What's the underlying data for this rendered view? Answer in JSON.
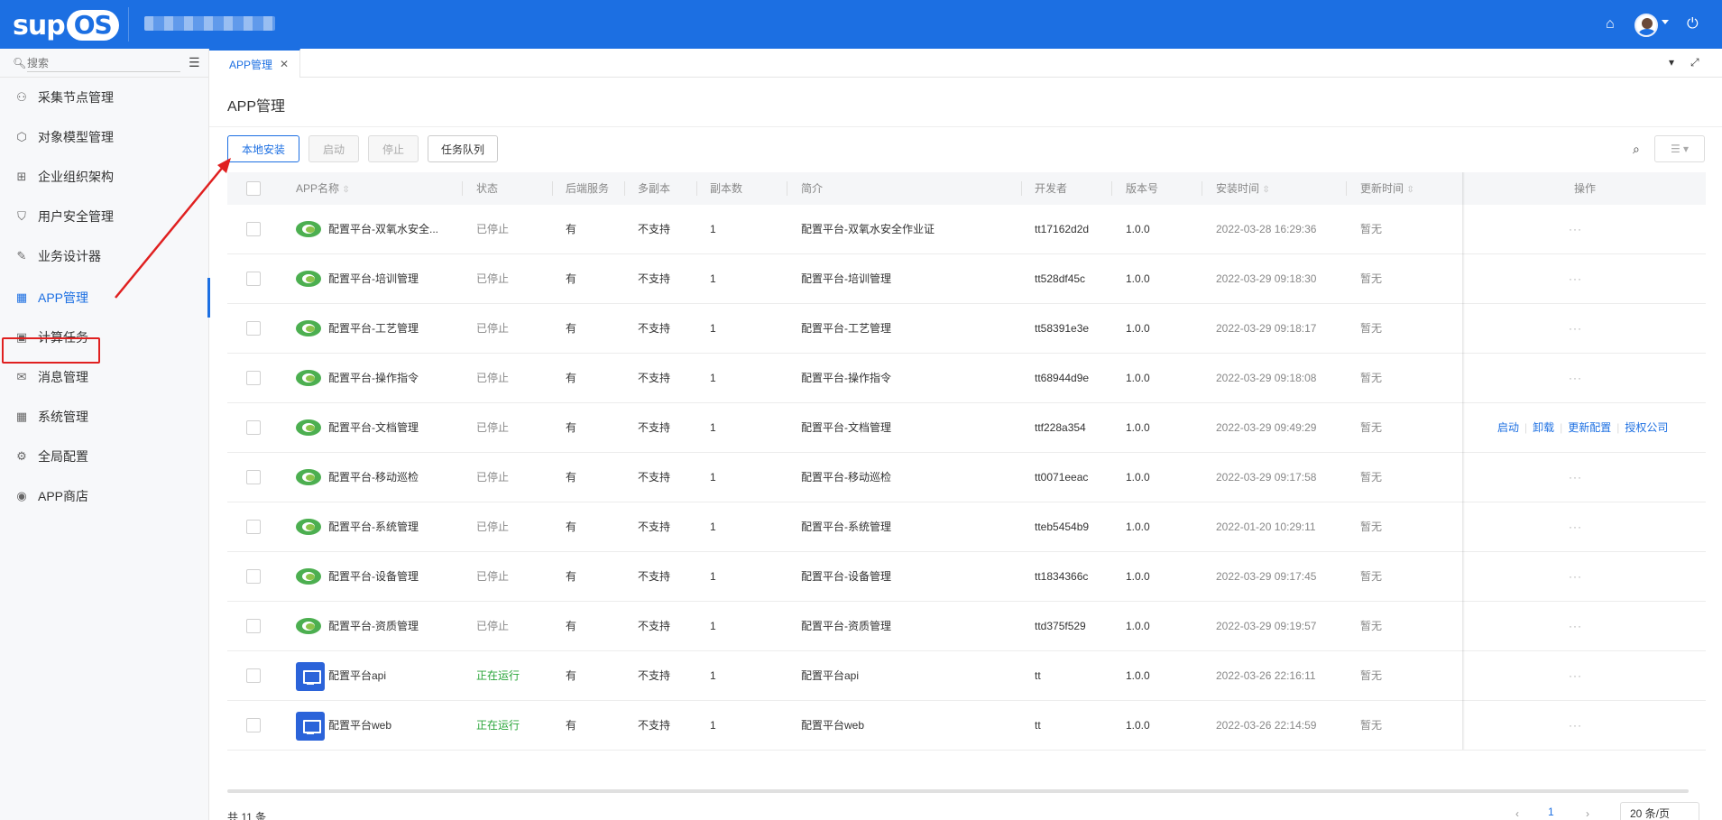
{
  "header": {
    "logo": {
      "sup": "sup",
      "os": "OS"
    },
    "home_icon": "home-icon",
    "power_icon": "power-icon"
  },
  "sidebar": {
    "search_placeholder": "搜索",
    "items": [
      {
        "label": "采集节点管理",
        "icon": "nodes-icon"
      },
      {
        "label": "对象模型管理",
        "icon": "cube-icon"
      },
      {
        "label": "企业组织架构",
        "icon": "org-icon"
      },
      {
        "label": "用户安全管理",
        "icon": "shield-icon"
      },
      {
        "label": "业务设计器",
        "icon": "designer-icon"
      },
      {
        "label": "APP管理",
        "icon": "grid-icon",
        "active": true
      },
      {
        "label": "计算任务",
        "icon": "calc-icon"
      },
      {
        "label": "消息管理",
        "icon": "message-icon"
      },
      {
        "label": "系统管理",
        "icon": "grid-icon"
      },
      {
        "label": "全局配置",
        "icon": "gear-icon"
      },
      {
        "label": "APP商店",
        "icon": "store-icon"
      }
    ]
  },
  "tabs": [
    {
      "label": "APP管理",
      "active": true
    }
  ],
  "page": {
    "title": "APP管理",
    "buttons": {
      "install": "本地安装",
      "start": "启动",
      "stop": "停止",
      "queue": "任务队列"
    }
  },
  "table": {
    "columns": [
      "APP名称",
      "状态",
      "后端服务",
      "多副本",
      "副本数",
      "简介",
      "开发者",
      "版本号",
      "安装时间",
      "更新时间",
      "操作"
    ],
    "rows": [
      {
        "icon": "leaf",
        "name": "配置平台-双氧水安全...",
        "status": "已停止",
        "backend": "有",
        "multi": "不支持",
        "replicas": "1",
        "desc": "配置平台-双氧水安全作业证",
        "dev": "tt17162d2d",
        "version": "1.0.0",
        "installed": "2022-03-28 16:29:36",
        "updated": "暂无",
        "ops": "···"
      },
      {
        "icon": "leaf",
        "name": "配置平台-培训管理",
        "status": "已停止",
        "backend": "有",
        "multi": "不支持",
        "replicas": "1",
        "desc": "配置平台-培训管理",
        "dev": "tt528df45c",
        "version": "1.0.0",
        "installed": "2022-03-29 09:18:30",
        "updated": "暂无",
        "ops": "···"
      },
      {
        "icon": "leaf",
        "name": "配置平台-工艺管理",
        "status": "已停止",
        "backend": "有",
        "multi": "不支持",
        "replicas": "1",
        "desc": "配置平台-工艺管理",
        "dev": "tt58391e3e",
        "version": "1.0.0",
        "installed": "2022-03-29 09:18:17",
        "updated": "暂无",
        "ops": "···"
      },
      {
        "icon": "leaf",
        "name": "配置平台-操作指令",
        "status": "已停止",
        "backend": "有",
        "multi": "不支持",
        "replicas": "1",
        "desc": "配置平台-操作指令",
        "dev": "tt68944d9e",
        "version": "1.0.0",
        "installed": "2022-03-29 09:18:08",
        "updated": "暂无",
        "ops": "···"
      },
      {
        "icon": "leaf",
        "name": "配置平台-文档管理",
        "status": "已停止",
        "backend": "有",
        "multi": "不支持",
        "replicas": "1",
        "desc": "配置平台-文档管理",
        "dev": "ttf228a354",
        "version": "1.0.0",
        "installed": "2022-03-29 09:49:29",
        "updated": "暂无",
        "ops_links": [
          "启动",
          "卸载",
          "更新配置",
          "授权公司"
        ]
      },
      {
        "icon": "leaf",
        "name": "配置平台-移动巡检",
        "status": "已停止",
        "backend": "有",
        "multi": "不支持",
        "replicas": "1",
        "desc": "配置平台-移动巡检",
        "dev": "tt0071eeac",
        "version": "1.0.0",
        "installed": "2022-03-29 09:17:58",
        "updated": "暂无",
        "ops": "···"
      },
      {
        "icon": "leaf",
        "name": "配置平台-系统管理",
        "status": "已停止",
        "backend": "有",
        "multi": "不支持",
        "replicas": "1",
        "desc": "配置平台-系统管理",
        "dev": "tteb5454b9",
        "version": "1.0.0",
        "installed": "2022-01-20 10:29:11",
        "updated": "暂无",
        "ops": "···"
      },
      {
        "icon": "leaf",
        "name": "配置平台-设备管理",
        "status": "已停止",
        "backend": "有",
        "multi": "不支持",
        "replicas": "1",
        "desc": "配置平台-设备管理",
        "dev": "tt1834366c",
        "version": "1.0.0",
        "installed": "2022-03-29 09:17:45",
        "updated": "暂无",
        "ops": "···"
      },
      {
        "icon": "leaf",
        "name": "配置平台-资质管理",
        "status": "已停止",
        "backend": "有",
        "multi": "不支持",
        "replicas": "1",
        "desc": "配置平台-资质管理",
        "dev": "ttd375f529",
        "version": "1.0.0",
        "installed": "2022-03-29 09:19:57",
        "updated": "暂无",
        "ops": "···"
      },
      {
        "icon": "screen",
        "name": "配置平台api",
        "status": "正在运行",
        "backend": "有",
        "multi": "不支持",
        "replicas": "1",
        "desc": "配置平台api",
        "dev": "tt",
        "version": "1.0.0",
        "installed": "2022-03-26 22:16:11",
        "updated": "暂无",
        "ops": "···"
      },
      {
        "icon": "screen",
        "name": "配置平台web",
        "status": "正在运行",
        "backend": "有",
        "multi": "不支持",
        "replicas": "1",
        "desc": "配置平台web",
        "dev": "tt",
        "version": "1.0.0",
        "installed": "2022-03-26 22:14:59",
        "updated": "暂无",
        "ops": "···"
      }
    ]
  },
  "footer": {
    "total": "共 11 条",
    "page": "1",
    "page_size": "20 条/页"
  },
  "colors": {
    "brand": "#1c6fe2",
    "running": "#2aa53a",
    "annotation": "#e02020"
  }
}
